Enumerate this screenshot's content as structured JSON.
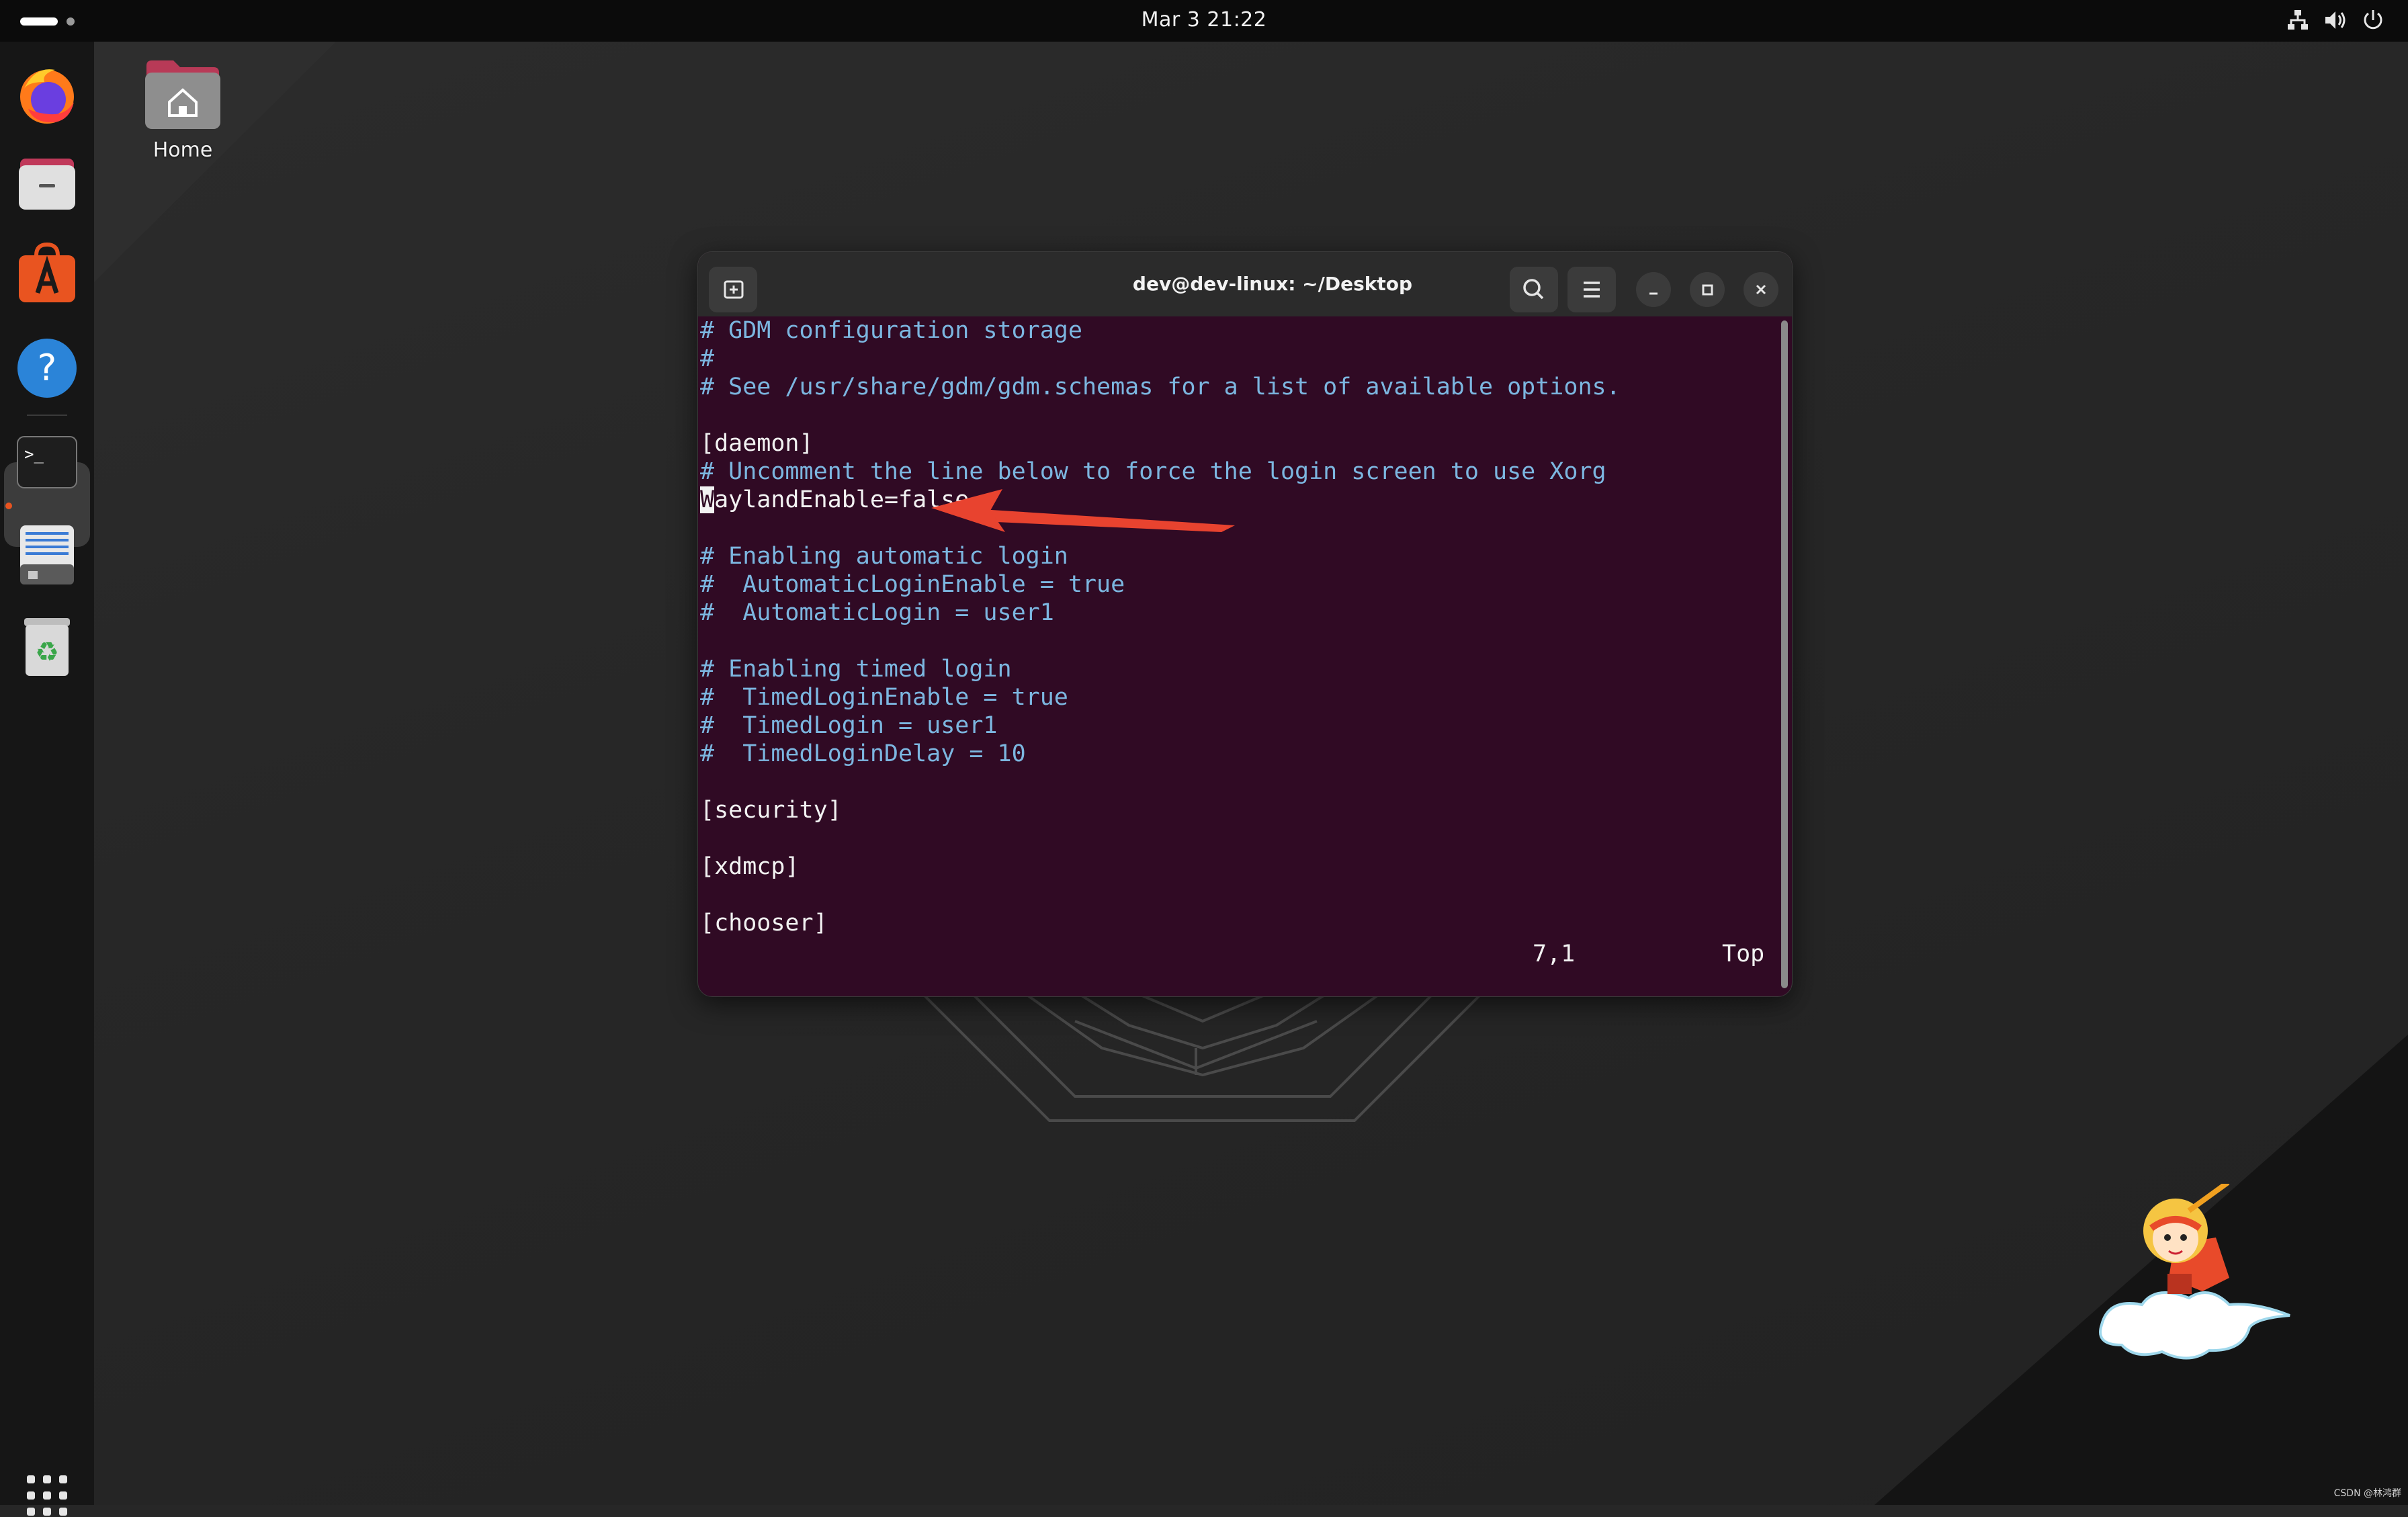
{
  "topbar": {
    "clock": "Mar 3  21:22",
    "icons": [
      "network-icon",
      "volume-icon",
      "power-icon"
    ]
  },
  "dock": {
    "apps": [
      {
        "name": "firefox",
        "icon": "firefox-icon"
      },
      {
        "name": "files",
        "icon": "files-icon"
      },
      {
        "name": "app-center",
        "icon": "app-center-icon"
      },
      {
        "name": "help",
        "icon": "help-icon"
      },
      {
        "name": "terminal",
        "icon": "terminal-icon",
        "active": true
      },
      {
        "name": "text-editor",
        "icon": "text-editor-icon"
      },
      {
        "name": "trash",
        "icon": "trash-icon"
      }
    ],
    "grid_icon": "show-apps-icon"
  },
  "desktop": {
    "home_label": "Home"
  },
  "terminal": {
    "title": "dev@dev-linux: ~/Desktop",
    "lines": [
      "# GDM configuration storage",
      "#",
      "# See /usr/share/gdm/gdm.schemas for a list of available options.",
      "",
      "[daemon]",
      "# Uncomment the line below to force the login screen to use Xorg",
      "WaylandEnable=false",
      "",
      "# Enabling automatic login",
      "#  AutomaticLoginEnable = true",
      "#  AutomaticLogin = user1",
      "",
      "# Enabling timed login",
      "#  TimedLoginEnable = true",
      "#  TimedLogin = user1",
      "#  TimedLoginDelay = 10",
      "",
      "[security]",
      "",
      "[xdmcp]",
      "",
      "[chooser]"
    ],
    "cursor_char": "W",
    "line7_rest": "aylandEnable=false",
    "status_position": "7,1",
    "status_scroll": "Top"
  },
  "colors": {
    "terminal_bg": "#300a24",
    "comment": "#7cb6e0",
    "arrow": "#e8432f",
    "accent": "#e95420"
  },
  "watermark": "CSDN @林鸿群"
}
